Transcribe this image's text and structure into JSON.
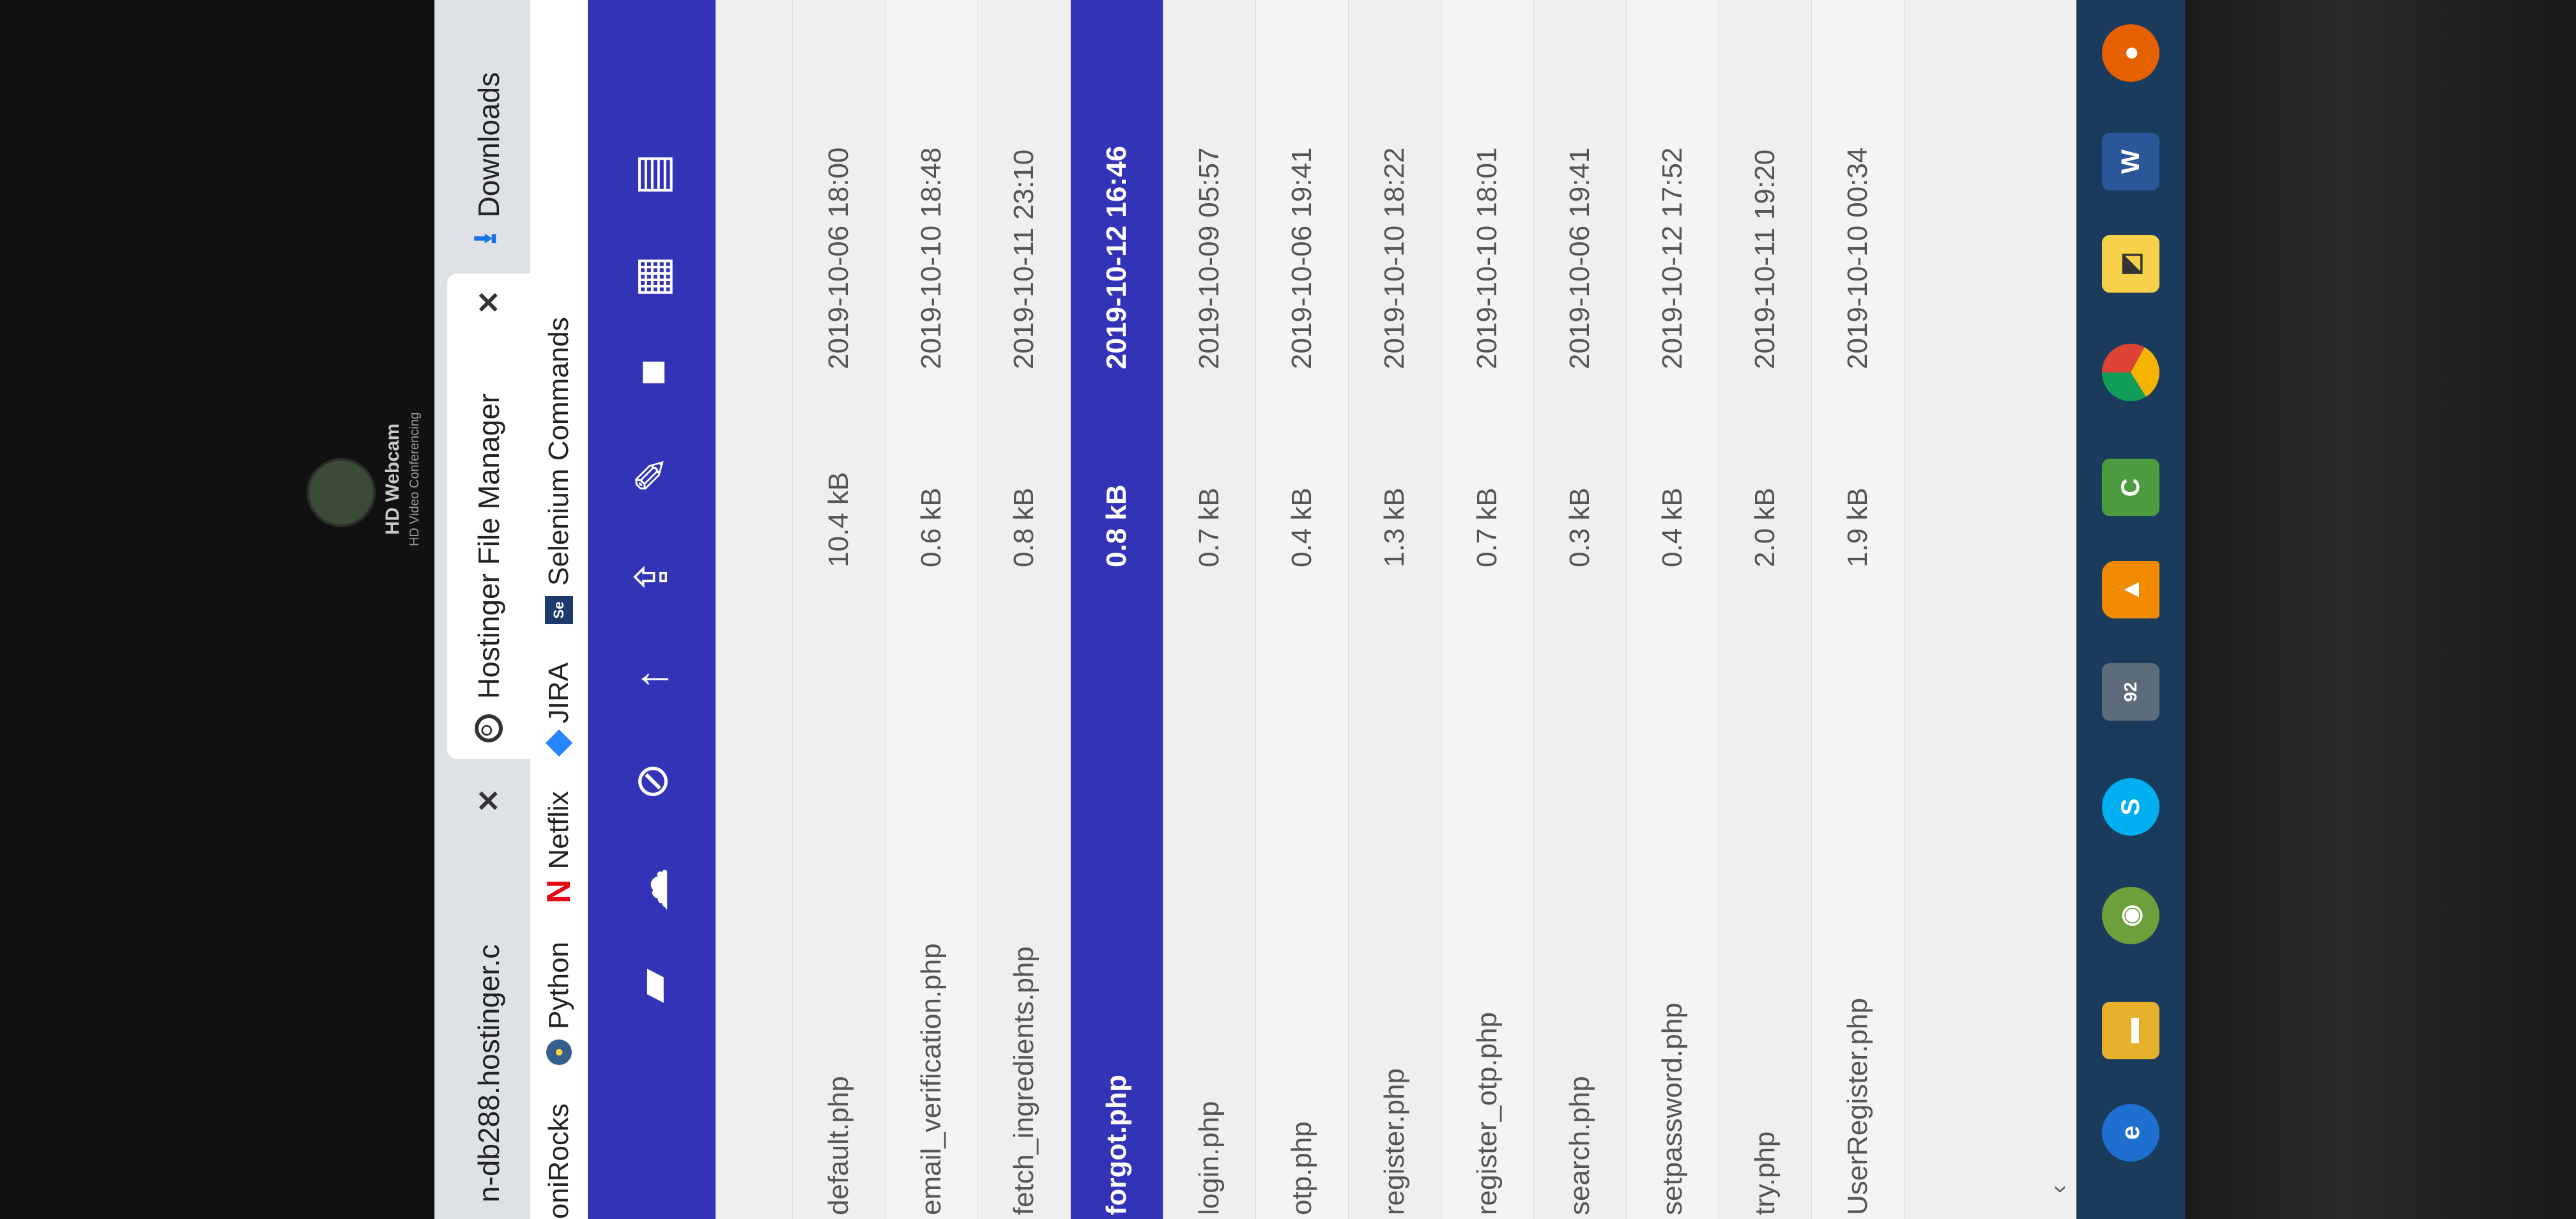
{
  "browser": {
    "tabs": [
      {
        "label": "n-db288.hostinger.c",
        "active": false
      },
      {
        "label": "Hostinger File Manager",
        "active": true
      },
      {
        "label": "Downloads",
        "active": false
      }
    ],
    "bookmarks": [
      "oniRocks",
      "Python",
      "Netflix",
      "JIRA",
      "Selenium Commands"
    ]
  },
  "webcam": {
    "title": "HD Webcam",
    "subtitle": "HD Video Conferencing"
  },
  "toolbar_icons": [
    "folder-icon",
    "cloud-upload-icon",
    "new-file-icon",
    "upload-icon",
    "share-icon",
    "edit-icon",
    "lock-icon",
    "archive-icon",
    "delete-icon"
  ],
  "files": [
    {
      "name": "default.php",
      "size": "10.4 kB",
      "date": "2019-10-06 18:00",
      "selected": false
    },
    {
      "name": "email_verification.php",
      "size": "0.6 kB",
      "date": "2019-10-10 18:48",
      "selected": false
    },
    {
      "name": "fetch_ingredients.php",
      "size": "0.8 kB",
      "date": "2019-10-11 23:10",
      "selected": false
    },
    {
      "name": "forgot.php",
      "size": "0.8 kB",
      "date": "2019-10-12 16:46",
      "selected": true
    },
    {
      "name": "login.php",
      "size": "0.7 kB",
      "date": "2019-10-09 05:57",
      "selected": false
    },
    {
      "name": "otp.php",
      "size": "0.4 kB",
      "date": "2019-10-06 19:41",
      "selected": false
    },
    {
      "name": "register.php",
      "size": "1.3 kB",
      "date": "2019-10-10 18:22",
      "selected": false
    },
    {
      "name": "register_otp.php",
      "size": "0.7 kB",
      "date": "2019-10-10 18:01",
      "selected": false
    },
    {
      "name": "search.php",
      "size": "0.3 kB",
      "date": "2019-10-06 19:41",
      "selected": false
    },
    {
      "name": "setpassword.php",
      "size": "0.4 kB",
      "date": "2019-10-12 17:52",
      "selected": false
    },
    {
      "name": "try.php",
      "size": "2.0 kB",
      "date": "2019-10-11 19:20",
      "selected": false
    },
    {
      "name": "UserRegister.php",
      "size": "1.9 kB",
      "date": "2019-10-10 00:34",
      "selected": false
    }
  ],
  "taskbar": {
    "mail_badge": "92",
    "word_label": "W",
    "camtasia_label": "C",
    "skype_label": "S",
    "ie_label": "e"
  },
  "brand": {
    "toolbar_color": "#3333b8",
    "selected_color": "#3333b8"
  }
}
